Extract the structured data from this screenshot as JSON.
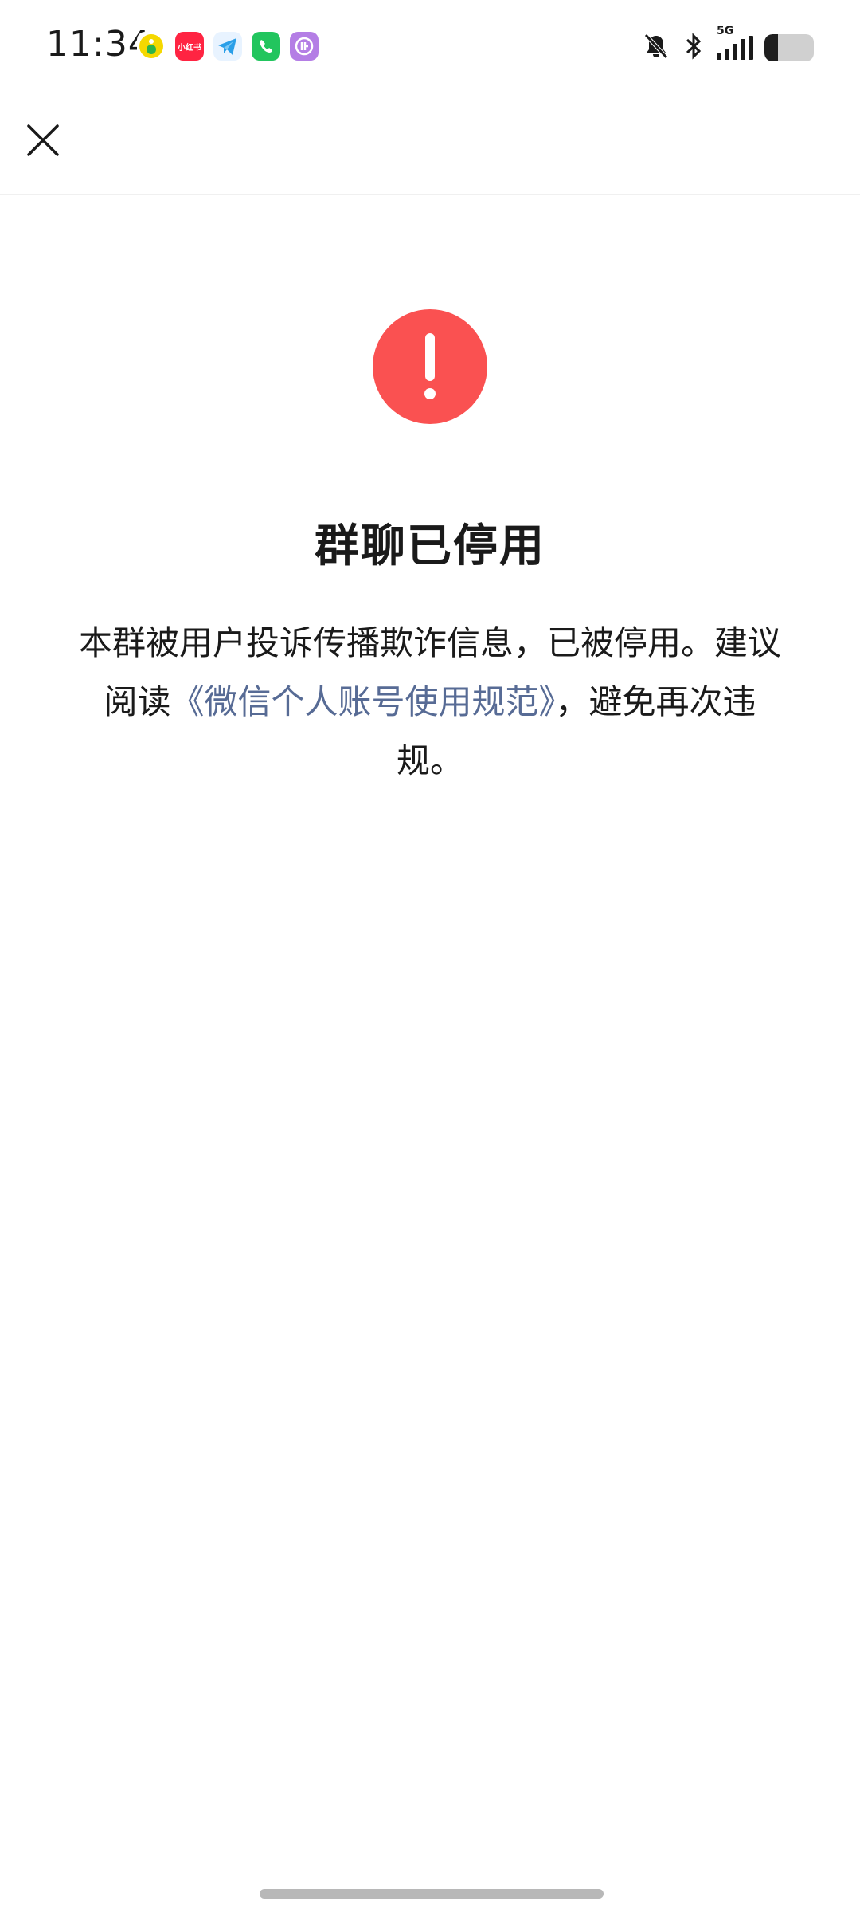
{
  "status_bar": {
    "time": "11:34",
    "notification_icons": [
      "music-app-icon",
      "xiaohongshu-icon",
      "telegram-icon",
      "phone-app-icon",
      "purple-app-icon"
    ],
    "redbook_label": "小红书",
    "network": "5G",
    "battery_level_percent": 28
  },
  "nav": {
    "close_icon": "close-icon"
  },
  "main": {
    "icon": "exclamation-circle-icon",
    "icon_color": "#fa5151",
    "title": "群聊已停用",
    "desc_part1": "本群被用户投诉传播欺诈信息，已被停用。建议阅读",
    "link_text": "《微信个人账号使用规范》",
    "link_color": "#576b95",
    "desc_part2": "，避免再次违规。"
  }
}
